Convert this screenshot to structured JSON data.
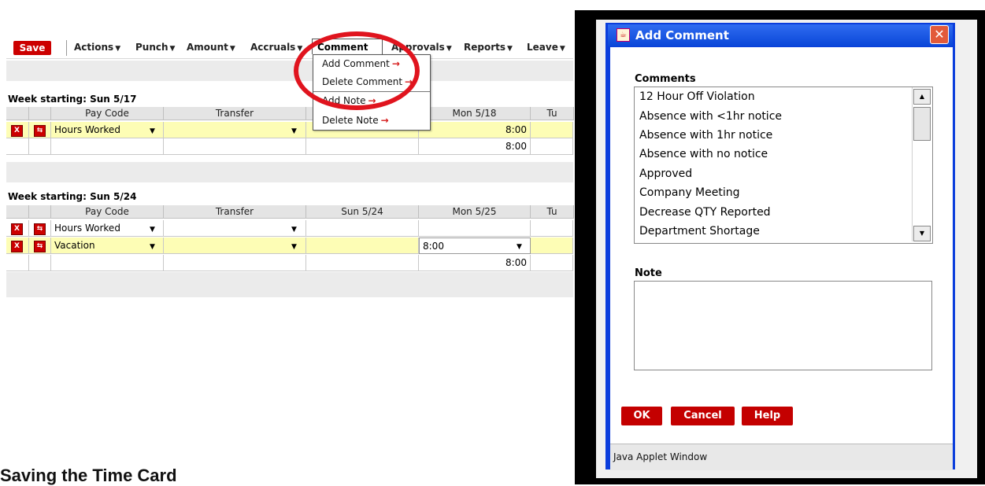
{
  "toolbar": {
    "save_label": "Save",
    "menus": [
      "Actions",
      "Punch",
      "Amount",
      "Accruals",
      "Comment",
      "Approvals",
      "Reports",
      "Leave"
    ]
  },
  "dropdown": {
    "items": [
      "Add Comment",
      "Delete Comment",
      "Add Note",
      "Delete Note"
    ],
    "arrow": "→"
  },
  "week1": {
    "label": "Week starting: Sun 5/17",
    "headers": [
      "Pay Code",
      "Transfer",
      "Mon 5/18",
      "Tu"
    ],
    "row1_paycode": "Hours Worked",
    "row1_mon": "8:00",
    "total_mon": "8:00"
  },
  "week2": {
    "label": "Week starting: Sun 5/24",
    "headers": [
      "Pay Code",
      "Transfer",
      "Sun 5/24",
      "Mon 5/25",
      "Tu"
    ],
    "row1_paycode": "Hours Worked",
    "row2_paycode": "Vacation",
    "row2_mon": "8:00",
    "total_mon": "8:00"
  },
  "dialog": {
    "title": "Add Comment",
    "comments_label": "Comments",
    "comments": [
      "12 Hour Off Violation",
      "Absence with <1hr notice",
      "Absence with 1hr notice",
      "Absence with no notice",
      "Approved",
      "Company Meeting",
      "Decrease QTY Reported",
      "Department Shortage"
    ],
    "note_label": "Note",
    "buttons": {
      "ok": "OK",
      "cancel": "Cancel",
      "help": "Help"
    },
    "footer": "Java Applet Window"
  },
  "heading": "Saving the Time Card",
  "colors": {
    "accent_red": "#cc0000",
    "title_blue": "#0a46d8",
    "row_yellow": "#fdfdb5"
  }
}
